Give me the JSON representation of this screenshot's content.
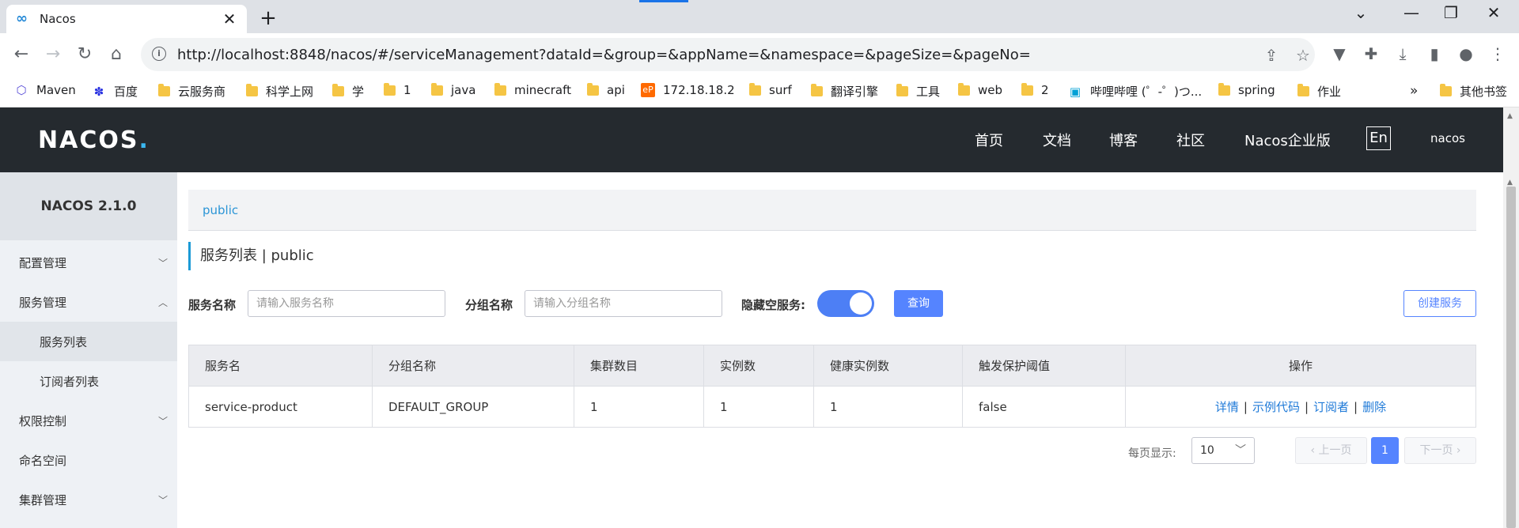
{
  "browser": {
    "tab_title": "Nacos",
    "tab_close": "✕",
    "new_tab": "+",
    "url": "http://localhost:8848/nacos/#/serviceManagement?dataId=&group=&appName=&namespace=&pageSize=&pageNo=",
    "win_minimize": "⌄",
    "win_min": "—",
    "win_restore": "❐",
    "win_close": "✕"
  },
  "bookmarks": {
    "items": [
      "Maven",
      "百度",
      "云服务商",
      "科学上网",
      "学",
      "1",
      "java",
      "minecraft",
      "api",
      "172.18.18.2",
      "surf",
      "翻译引擎",
      "工具",
      "web",
      "2",
      "哔哩哔哩 (゜-゜)つ...",
      "spring",
      "作业"
    ],
    "more": "»",
    "other": "其他书签"
  },
  "header": {
    "logo": "NACOS",
    "logo_dot": ".",
    "nav": [
      "首页",
      "文档",
      "博客",
      "社区",
      "Nacos企业版"
    ],
    "lang": "En",
    "user": "nacos"
  },
  "sidebar": {
    "title": "NACOS 2.1.0",
    "items": [
      "配置管理",
      "服务管理",
      "服务列表",
      "订阅者列表",
      "权限控制",
      "命名空间",
      "集群管理"
    ]
  },
  "main": {
    "namespace": "public",
    "title": "服务列表  |  public",
    "search": {
      "service_label": "服务名称",
      "service_placeholder": "请输入服务名称",
      "group_label": "分组名称",
      "group_placeholder": "请输入分组名称",
      "hide_empty_label": "隐藏空服务:",
      "hide_empty_on": true,
      "query_button": "查询",
      "create_button": "创建服务"
    },
    "table": {
      "columns": [
        "服务名",
        "分组名称",
        "集群数目",
        "实例数",
        "健康实例数",
        "触发保护阈值",
        "操作"
      ],
      "rows": [
        {
          "name": "service-product",
          "group": "DEFAULT_GROUP",
          "clusters": "1",
          "instances": "1",
          "healthy": "1",
          "threshold": "false",
          "ops": [
            "详情",
            "示例代码",
            "订阅者",
            "删除"
          ]
        }
      ]
    },
    "pager": {
      "page_size_label": "每页显示:",
      "page_size": "10",
      "prev": "上一页",
      "current": "1",
      "next": "下一页"
    }
  },
  "colors": {
    "header_bg": "#252a2f",
    "primary": "#5584ff",
    "link": "#1f7ad8"
  }
}
